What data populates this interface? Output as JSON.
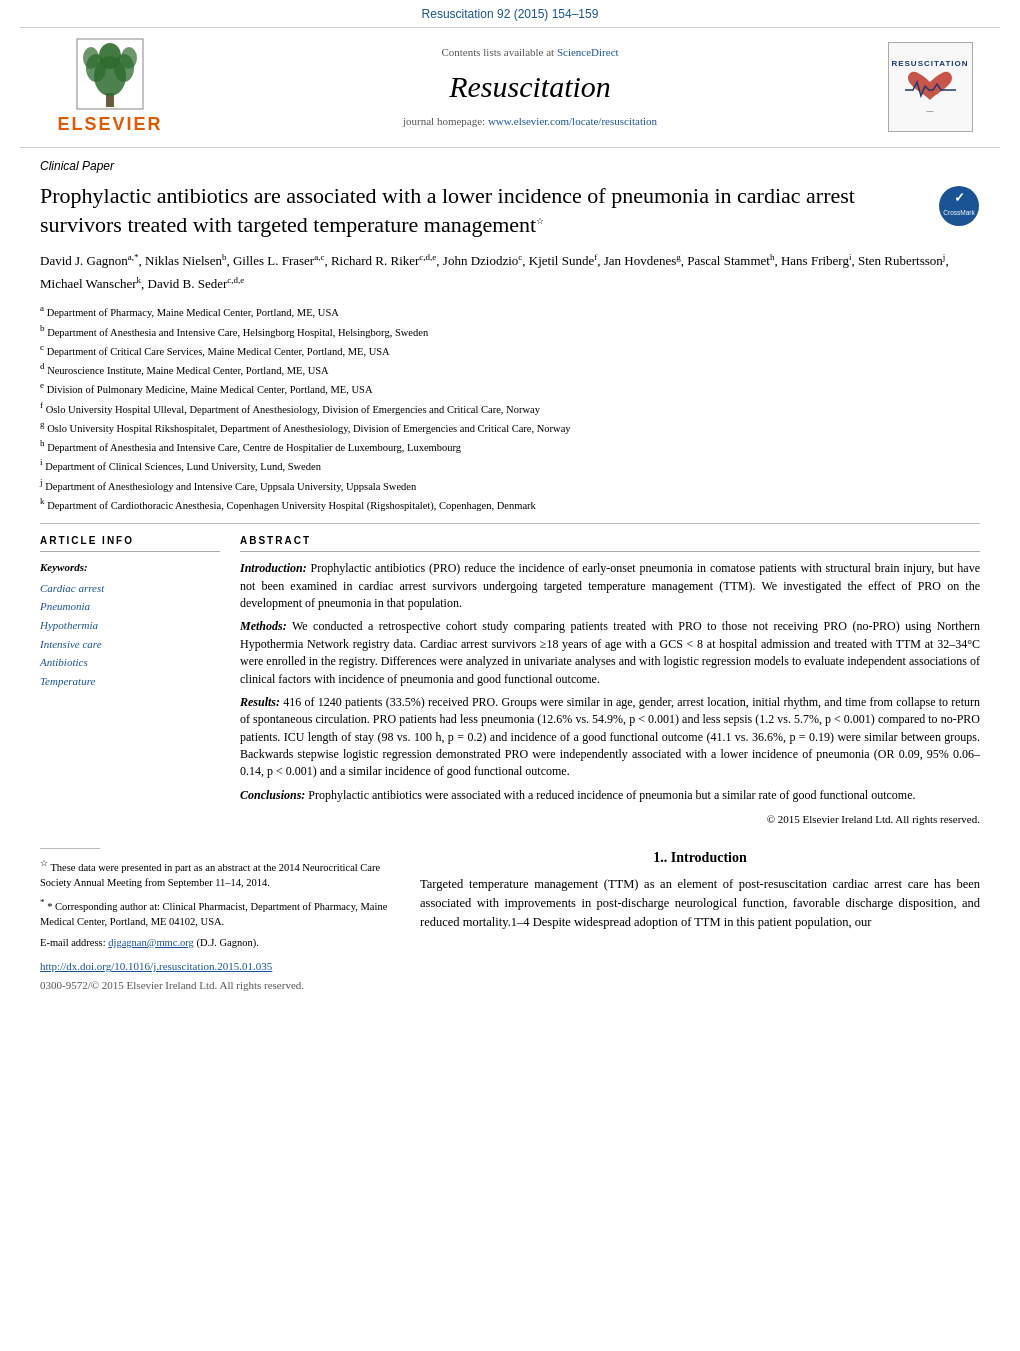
{
  "top_bar": {
    "journal_ref": "Resuscitation 92 (2015) 154–159",
    "journal_ref_url": "#"
  },
  "header": {
    "elsevier_label": "ELSEVIER",
    "contents_line": "Contents lists available at",
    "sciencedirect_label": "ScienceDirect",
    "journal_name": "Resuscitation",
    "homepage_label": "journal homepage:",
    "homepage_url": "www.elsevier.com/locate/resuscitation",
    "logo_title": "RESUSCITATION"
  },
  "article": {
    "section_label": "Clinical Paper",
    "title": "Prophylactic antibiotics are associated with a lower incidence of pneumonia in cardiac arrest survivors treated with targeted temperature management",
    "star_symbol": "☆",
    "authors": "David J. Gagnon",
    "author_superscripts": "a,*, Niklas Nielsen b, Gilles L. Fraser a,c, Richard R. Riker c,d,e, John Dziodzio c, Kjetil Sunde f, Jan Hovdenes g, Pascal Stammet h, Hans Friberg i, Sten Rubertsson j, Michael Wanscher k, David B. Seder c,d,e",
    "affiliations": [
      {
        "key": "a",
        "text": "Department of Pharmacy, Maine Medical Center, Portland, ME, USA"
      },
      {
        "key": "b",
        "text": "Department of Anesthesia and Intensive Care, Helsingborg Hospital, Helsingborg, Sweden"
      },
      {
        "key": "c",
        "text": "Department of Critical Care Services, Maine Medical Center, Portland, ME, USA"
      },
      {
        "key": "d",
        "text": "Neuroscience Institute, Maine Medical Center, Portland, ME, USA"
      },
      {
        "key": "e",
        "text": "Division of Pulmonary Medicine, Maine Medical Center, Portland, ME, USA"
      },
      {
        "key": "f",
        "text": "Oslo University Hospital Ulleval, Department of Anesthesiology, Division of Emergencies and Critical Care, Norway"
      },
      {
        "key": "g",
        "text": "Oslo University Hospital Rikshospitalet, Department of Anesthesiology, Division of Emergencies and Critical Care, Norway"
      },
      {
        "key": "h",
        "text": "Department of Anesthesia and Intensive Care, Centre de Hospitalier de Luxembourg, Luxembourg"
      },
      {
        "key": "i",
        "text": "Department of Clinical Sciences, Lund University, Lund, Sweden"
      },
      {
        "key": "j",
        "text": "Department of Anesthesiology and Intensive Care, Uppsala University, Uppsala Sweden"
      },
      {
        "key": "k",
        "text": "Department of Cardiothoracic Anesthesia, Copenhagen University Hospital (Rigshospitalet), Copenhagen, Denmark"
      }
    ],
    "article_info": {
      "header": "ARTICLE INFO",
      "keywords_label": "Keywords:",
      "keywords": [
        "Cardiac arrest",
        "Pneumonia",
        "Hypothermia",
        "Intensive care",
        "Antibiotics",
        "Temperature"
      ]
    },
    "abstract": {
      "header": "ABSTRACT",
      "introduction_label": "Introduction:",
      "introduction_text": "Prophylactic antibiotics (PRO) reduce the incidence of early-onset pneumonia in comatose patients with structural brain injury, but have not been examined in cardiac arrest survivors undergoing targeted temperature management (TTM). We investigated the effect of PRO on the development of pneumonia in that population.",
      "methods_label": "Methods:",
      "methods_text": "We conducted a retrospective cohort study comparing patients treated with PRO to those not receiving PRO (no-PRO) using Northern Hypothermia Network registry data. Cardiac arrest survivors ≥18 years of age with a GCS < 8 at hospital admission and treated with TTM at 32–34°C were enrolled in the registry. Differences were analyzed in univariate analyses and with logistic regression models to evaluate independent associations of clinical factors with incidence of pneumonia and good functional outcome.",
      "results_label": "Results:",
      "results_text": "416 of 1240 patients (33.5%) received PRO. Groups were similar in age, gender, arrest location, initial rhythm, and time from collapse to return of spontaneous circulation. PRO patients had less pneumonia (12.6% vs. 54.9%, p < 0.001) and less sepsis (1.2 vs. 5.7%, p < 0.001) compared to no-PRO patients. ICU length of stay (98 vs. 100 h, p = 0.2) and incidence of a good functional outcome (41.1 vs. 36.6%, p = 0.19) were similar between groups. Backwards stepwise logistic regression demonstrated PRO were independently associated with a lower incidence of pneumonia (OR 0.09, 95% 0.06–0.14, p < 0.001) and a similar incidence of good functional outcome.",
      "conclusions_label": "Conclusions:",
      "conclusions_text": "Prophylactic antibiotics were associated with a reduced incidence of pneumonia but a similar rate of good functional outcome.",
      "copyright": "© 2015 Elsevier Ireland Ltd. All rights reserved."
    }
  },
  "footnotes": {
    "star_note": "These data were presented in part as an abstract at the 2014 Neurocritical Care Society Annual Meeting from September 11–14, 2014.",
    "corresponding_label": "* Corresponding author at:",
    "corresponding_text": "Clinical Pharmacist, Department of Pharmacy, Maine Medical Center, Portland, ME 04102, USA.",
    "email_label": "E-mail address:",
    "email": "djgagnan@mmc.org",
    "email_suffix": "(D.J. Gagnon).",
    "doi": "http://dx.doi.org/10.1016/j.resuscitation.2015.01.035",
    "issn": "0300-9572/© 2015 Elsevier Ireland Ltd. All rights reserved."
  },
  "introduction": {
    "section_label": "1.",
    "section_title": "Introduction",
    "paragraph": "Targeted temperature management (TTM) as an element of post-resuscitation cardiac arrest care has been associated with improvements in post-discharge neurological function, favorable discharge disposition, and reduced mortality.1–4 Despite widespread adoption of TTM in this patient population, our"
  }
}
